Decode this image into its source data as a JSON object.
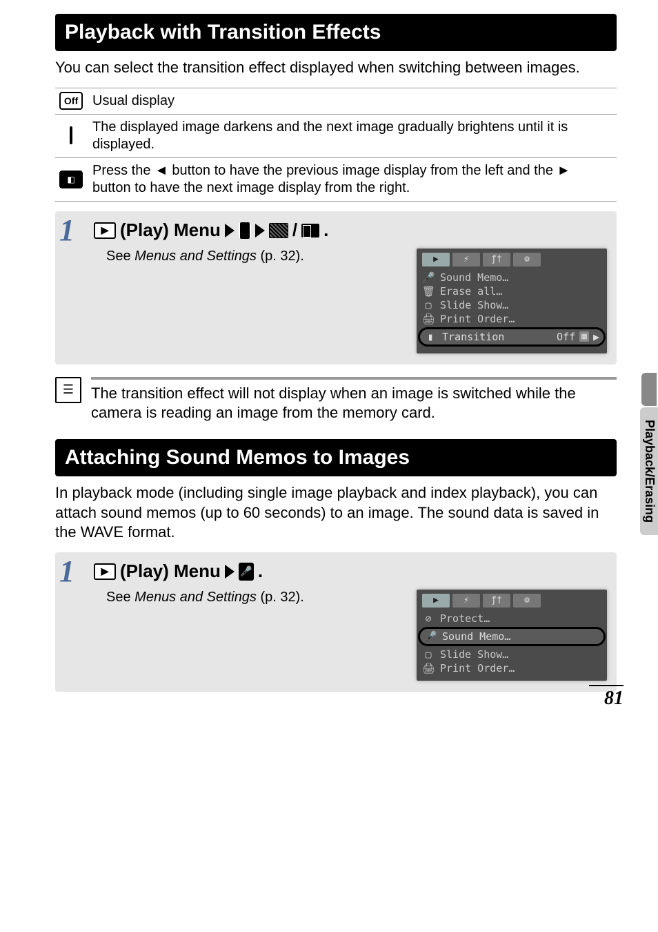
{
  "side_tab": "Playback/Erasing",
  "page_number": "81",
  "section1": {
    "heading": "Playback with Transition Effects",
    "intro": "You can select the transition effect displayed when switching between images.",
    "table": {
      "row1": "Usual display",
      "row2": "The displayed image darkens and the next image gradually brightens until it is displayed.",
      "row3a": "Press the ",
      "row3b": " button to have the previous image display from the left and the ",
      "row3c": " button to have the next image display from the right."
    },
    "step": {
      "num": "1",
      "title_a": "(Play) Menu",
      "see_a": "See ",
      "see_b": "Menus and Settings",
      "see_c": " (p. 32).",
      "period": "."
    },
    "screen": {
      "items": [
        "Sound Memo…",
        "Erase all…",
        "Slide Show…",
        "Print Order…"
      ],
      "highlight_label": "Transition",
      "highlight_value": "Off"
    },
    "note": "The transition effect will not display when an image is switched while the camera is reading an image from the memory card."
  },
  "section2": {
    "heading": "Attaching Sound Memos to Images",
    "intro": "In playback mode (including single image playback and index playback), you can attach sound memos (up to 60 seconds) to an image. The sound data is saved in the WAVE format.",
    "step": {
      "num": "1",
      "title_a": "(Play) Menu",
      "see_a": "See ",
      "see_b": "Menus and Settings",
      "see_c": " (p. 32).",
      "period": "."
    },
    "screen": {
      "top_item": "Protect…",
      "highlight_label": "Sound Memo…",
      "items_after": [
        "Slide Show…",
        "Print Order…"
      ]
    }
  },
  "icons": {
    "off_label": "Off"
  }
}
